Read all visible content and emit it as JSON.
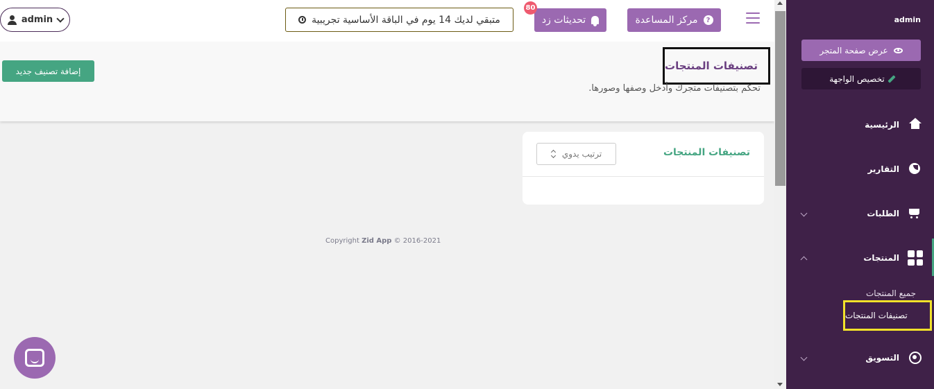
{
  "topbar": {
    "admin_label": "admin",
    "trial_text": "متبقي لديك 14 يوم في الباقة الأساسية تجريبية",
    "updates_label": "تحديثات زد",
    "updates_badge": "80",
    "help_label": "مركز المساعدة"
  },
  "page": {
    "title": "تصنيفات المنتجات",
    "subtitle": "تحكم بتصنيفات متجرك وأدخل وصفها وصورها.",
    "add_button": "إضافة تصنيف جديد"
  },
  "card": {
    "title": "تصنيفات المنتجات",
    "sort_value": "ترتيب يدوي"
  },
  "footer": {
    "prefix": "Copyright",
    "brand": "Zid App",
    "suffix": "© 2016-2021"
  },
  "sidebar": {
    "user": "admin",
    "store_button": "عرض صفحة المتجر",
    "customize_button": "تخصيص الواجهة",
    "items": [
      {
        "label": "الرئيسية",
        "icon": "home-icon"
      },
      {
        "label": "التقارير",
        "icon": "pie-chart-icon"
      },
      {
        "label": "الطلبات",
        "icon": "cart-icon"
      },
      {
        "label": "المنتجات",
        "icon": "grid-icon"
      },
      {
        "label": "التسويق",
        "icon": "target-icon"
      }
    ],
    "products_sub": {
      "all": "جميع المنتجات",
      "categories": "تصنيفات المنتجات"
    }
  },
  "colors": {
    "brand_purple": "#9b69b1",
    "sidebar_bg": "#3f2148",
    "accent_green": "#45a582",
    "badge_red": "#ee5a6f",
    "highlight_yellow": "#f2e22a"
  }
}
